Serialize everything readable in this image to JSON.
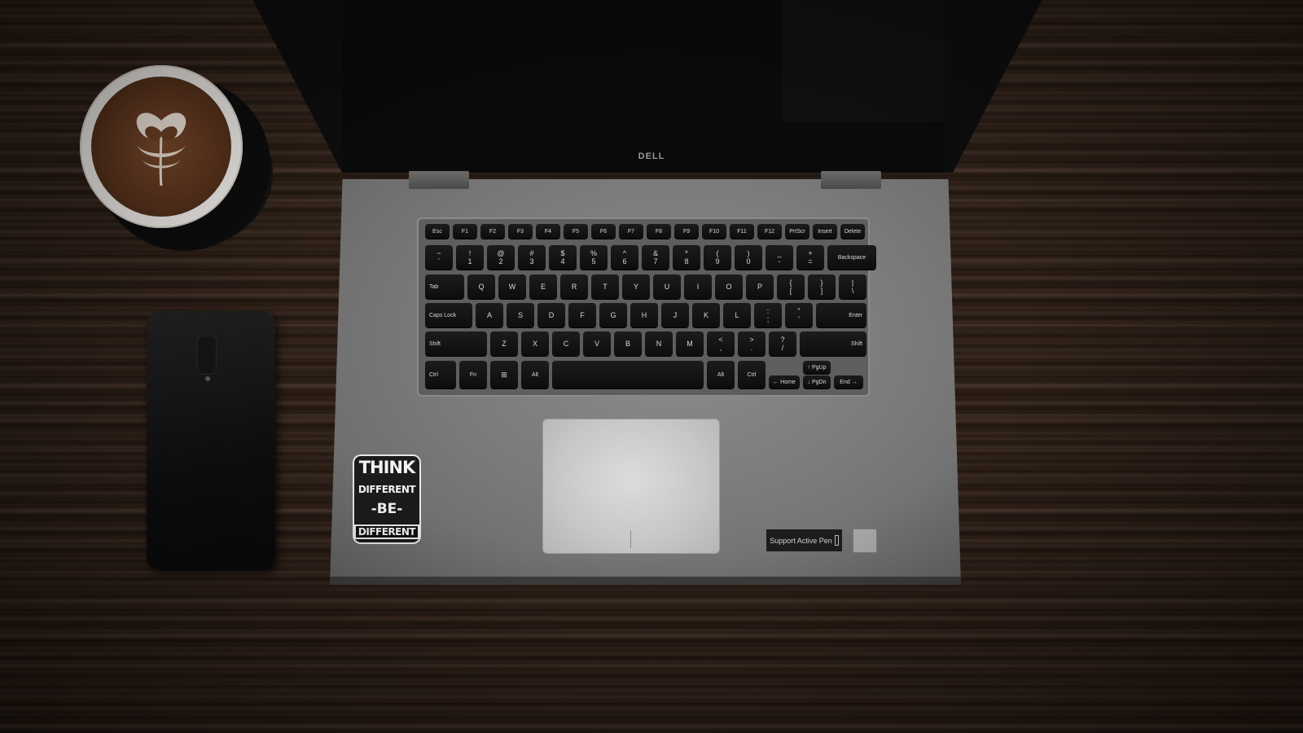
{
  "scene": {
    "laptop": {
      "brand": "DELL",
      "label": "Support Active Pen"
    },
    "sticker": {
      "lines": [
        "THINK",
        "DIFFERENT",
        "-BE-",
        "DIFFERENT"
      ]
    },
    "keyboard": {
      "row_fn": [
        "Esc",
        "F1",
        "F2",
        "F3",
        "F4",
        "F5",
        "F6",
        "F7",
        "F8",
        "F9",
        "F10",
        "F11",
        "F12",
        "PrtScr",
        "Insert",
        "Delete"
      ],
      "row_num": [
        {
          "top": "~",
          "bottom": "`"
        },
        {
          "top": "!",
          "bottom": "1"
        },
        {
          "top": "@",
          "bottom": "2"
        },
        {
          "top": "#",
          "bottom": "3"
        },
        {
          "top": "$",
          "bottom": "4"
        },
        {
          "top": "%",
          "bottom": "5"
        },
        {
          "top": "^",
          "bottom": "6"
        },
        {
          "top": "&",
          "bottom": "7"
        },
        {
          "top": "*",
          "bottom": "8"
        },
        {
          "top": "(",
          "bottom": "9"
        },
        {
          "top": ")",
          "bottom": "0"
        },
        {
          "top": "_",
          "bottom": "-"
        },
        {
          "top": "+",
          "bottom": "="
        }
      ],
      "backspace": "Backspace",
      "tab": "Tab",
      "row_q": [
        "Q",
        "W",
        "E",
        "R",
        "T",
        "Y",
        "U",
        "I",
        "O",
        "P"
      ],
      "row_q_extra": [
        {
          "top": "{",
          "bottom": "["
        },
        {
          "top": "}",
          "bottom": "]"
        },
        {
          "top": "|",
          "bottom": "\\"
        }
      ],
      "caps": "Caps Lock",
      "row_a": [
        "A",
        "S",
        "D",
        "F",
        "G",
        "H",
        "J",
        "K",
        "L"
      ],
      "row_a_extra": [
        {
          "top": ":",
          "bottom": ";"
        },
        {
          "top": "\"",
          "bottom": "'"
        }
      ],
      "enter": "Enter",
      "shift_l": "Shift",
      "row_z": [
        "Z",
        "X",
        "C",
        "V",
        "B",
        "N",
        "M"
      ],
      "row_z_extra": [
        {
          "top": "<",
          "bottom": ","
        },
        {
          "top": ">",
          "bottom": "."
        },
        {
          "top": "?",
          "bottom": "/"
        }
      ],
      "shift_r": "Shift",
      "ctrl_l": "Ctrl",
      "fn": "Fn",
      "win": "⊞",
      "alt_l": "Alt",
      "alt_r": "Alt",
      "ctrl_r": "Ctrl",
      "home": "← Home",
      "pgup": "↑ PgUp",
      "pgdn": "↓ PgDn",
      "end": "End →"
    }
  }
}
